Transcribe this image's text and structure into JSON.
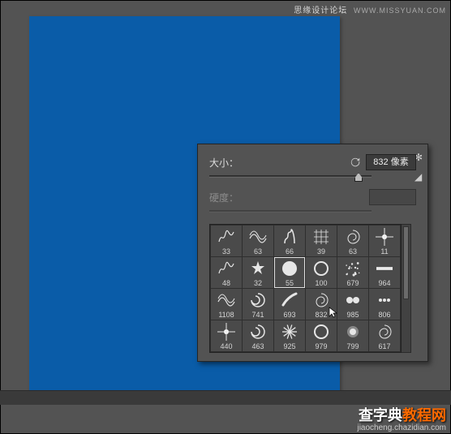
{
  "watermark_top": {
    "text": "思缘设计论坛",
    "url": "WWW.MISSYUAN.COM"
  },
  "watermark_bottom": {
    "brand_a": "查字典",
    "brand_b": "教程网",
    "url": "jiaocheng.chazidian.com"
  },
  "canvas": {
    "color": "#0a5ca8"
  },
  "panel": {
    "size_label": "大小：",
    "size_value": "832 像素",
    "size_slider_pos": 92,
    "hardness_label": "硬度：",
    "hardness_slider_pos": 0,
    "gear_glyph": "✻",
    "flyout_glyph": "◢"
  },
  "brushes": [
    {
      "v": "33",
      "t": "scribble"
    },
    {
      "v": "63",
      "t": "wave"
    },
    {
      "v": "66",
      "t": "smoke"
    },
    {
      "v": "39",
      "t": "net"
    },
    {
      "v": "63",
      "t": "spiral"
    },
    {
      "v": "11",
      "t": "flare"
    },
    {
      "v": "48",
      "t": "scribble"
    },
    {
      "v": "32",
      "t": "star"
    },
    {
      "v": "55",
      "t": "circle",
      "sel": true
    },
    {
      "v": "100",
      "t": "ring"
    },
    {
      "v": "679",
      "t": "spray"
    },
    {
      "v": "964",
      "t": "beam"
    },
    {
      "v": "1108",
      "t": "wave"
    },
    {
      "v": "741",
      "t": "swirl"
    },
    {
      "v": "693",
      "t": "comet"
    },
    {
      "v": "832",
      "t": "spiral",
      "cur": true
    },
    {
      "v": "985",
      "t": "pair"
    },
    {
      "v": "806",
      "t": "dots"
    },
    {
      "v": "440",
      "t": "flare"
    },
    {
      "v": "463",
      "t": "swirl"
    },
    {
      "v": "925",
      "t": "burst"
    },
    {
      "v": "979",
      "t": "ring"
    },
    {
      "v": "799",
      "t": "ball"
    },
    {
      "v": "617",
      "t": "spiral"
    }
  ]
}
